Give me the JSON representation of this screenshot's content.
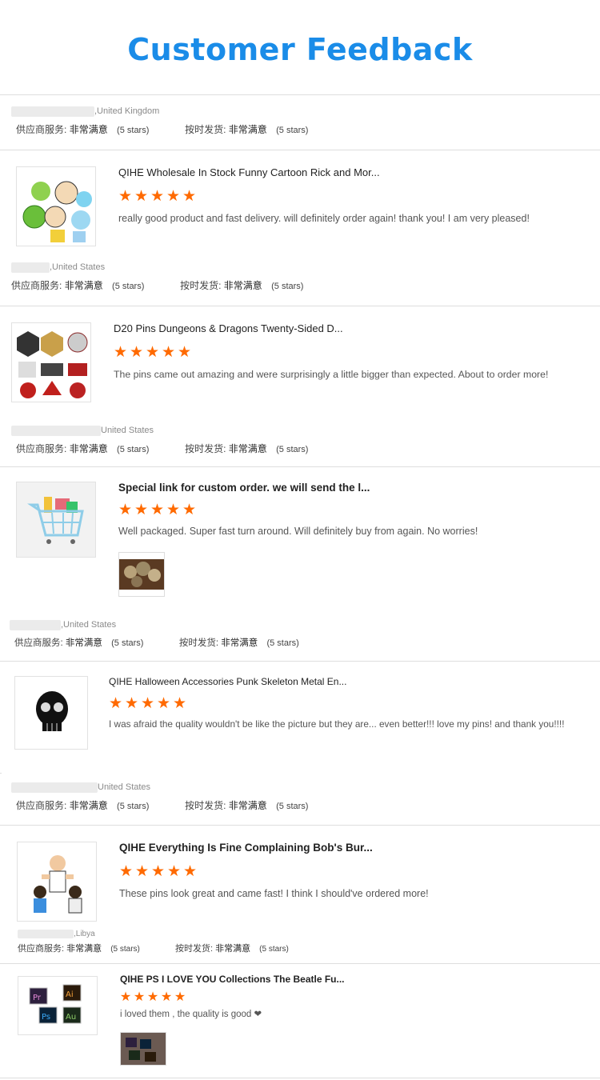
{
  "title": "Customer Feedback",
  "star_glyph": "★",
  "accent_color": "#1a8ce8",
  "star_color": "#ff6a00",
  "rating_labels": {
    "service": "供应商服务:",
    "delivery": "按时发货:",
    "value": "非常满意",
    "stars": "(5 stars)"
  },
  "reviews": [
    {
      "buyer_location": ",United Kingdom",
      "product_title": "QIHE Wholesale In Stock Funny Cartoon Rick and Mor...",
      "stars": 5,
      "comment": "really good product and fast delivery. will definitely order again! thank you! I am very pleased!",
      "thumbnail_icon": "cartoon-pins-image"
    },
    {
      "buyer_location": ",United States",
      "product_title": "D20 Pins Dungeons & Dragons Twenty-Sided D...",
      "stars": 5,
      "comment": "The pins came out amazing and were surprisingly a little bigger than expected. About to order more!",
      "thumbnail_icon": "dice-pins-image"
    },
    {
      "buyer_location": "United States",
      "product_title": "Special link for custom order. we will send the l...",
      "stars": 5,
      "comment": "Well packaged. Super fast turn around.  Will definitely buy from again.  No worries!",
      "thumbnail_icon": "shopping-cart-icon",
      "has_photo": true
    },
    {
      "buyer_location": ",United States",
      "product_title": "QIHE Halloween Accessories Punk Skeleton Metal En...",
      "stars": 5,
      "comment": "I was afraid the quality wouldn't be like the picture but they are... even better!!! love my pins! and thank you!!!!",
      "thumbnail_icon": "skull-pin-image"
    },
    {
      "buyer_location": "United States",
      "product_title": "QIHE Everything Is Fine Complaining Bob's Bur...",
      "stars": 5,
      "comment": "These pins look great and came fast! I think I should've ordered more!",
      "thumbnail_icon": "cartoon-characters-image"
    },
    {
      "buyer_location": ",Libya",
      "product_title": "QIHE PS I LOVE YOU Collections The Beatle Fu...",
      "stars": 5,
      "comment": "i loved them , the quality is good ❤",
      "thumbnail_icon": "software-icons-pins-image",
      "has_photo": true
    }
  ]
}
